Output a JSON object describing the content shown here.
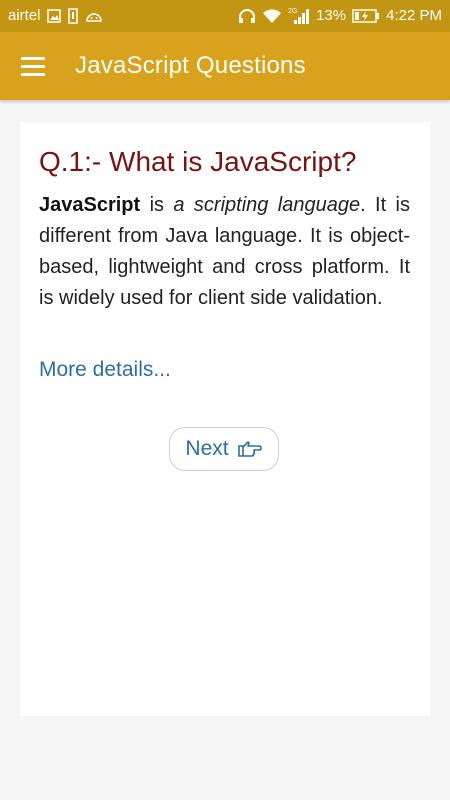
{
  "status_bar": {
    "carrier": "airtel",
    "network_type": "2G",
    "battery": "13%",
    "time": "4:22 PM"
  },
  "app_bar": {
    "title": "JavaScript Questions",
    "menu_icon": "hamburger-menu-icon",
    "color": "#d9a21c"
  },
  "question": {
    "title": "Q.1:- What is JavaScript?",
    "answer_bold": "JavaScript",
    "answer_mid": " is ",
    "answer_italic": "a scripting language",
    "answer_rest": ". It is different from Java language. It is object-based, lightweight and cross platform. It is widely used for client side validation.",
    "more_link": "More details...",
    "title_color": "#7a1212",
    "link_color": "#2a6fa6"
  },
  "navigation": {
    "next_label": "Next",
    "next_icon": "pointing-hand-icon"
  }
}
